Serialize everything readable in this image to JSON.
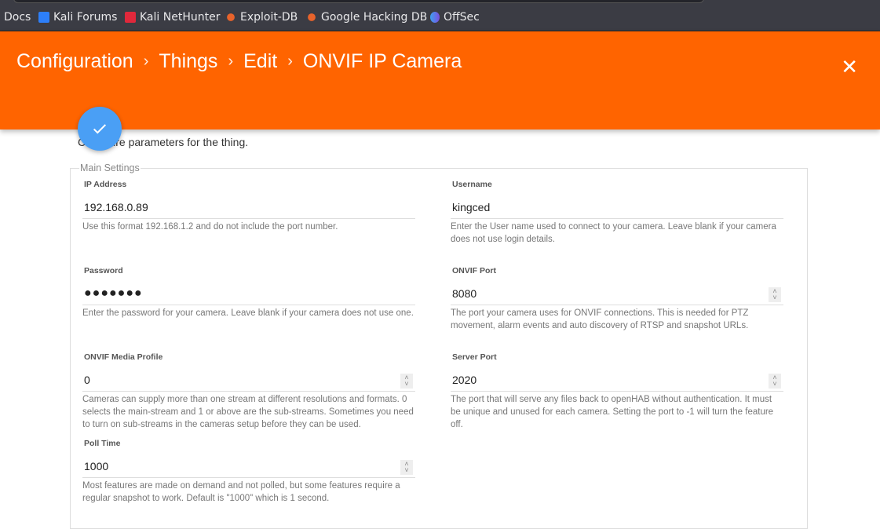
{
  "bookmarks": [
    {
      "label": "Docs",
      "icon": "none"
    },
    {
      "label": "Kali Forums",
      "icon": "kali-forums-icon",
      "color": "#2d7ff9"
    },
    {
      "label": "Kali NetHunter",
      "icon": "nethunter-icon",
      "color": "#e0283b"
    },
    {
      "label": "Exploit-DB",
      "icon": "exploitdb-icon",
      "color": "#e8632b"
    },
    {
      "label": "Google Hacking DB",
      "icon": "ghdb-icon",
      "color": "#e8632b"
    },
    {
      "label": "OffSec",
      "icon": "offsec-icon",
      "color": "#5a6cf0"
    }
  ],
  "header": {
    "crumbs": [
      "Configuration",
      "Things",
      "Edit",
      "ONVIF IP Camera"
    ],
    "close": "✕",
    "accent": "#ff6400"
  },
  "save_icon": "check-icon",
  "intro": "Configure parameters for the thing.",
  "group": "Main Settings",
  "fields": [
    {
      "label": "IP Address",
      "value": "192.168.0.89",
      "help": "Use this format 192.168.1.2 and do not include the port number."
    },
    {
      "label": "Username",
      "value": "kingced",
      "help": "Enter the User name used to connect to your camera. Leave blank if your camera does not use login details."
    },
    {
      "label": "Password",
      "value": "●●●●●●●",
      "help": "Enter the password for your camera. Leave blank if your camera does not use one."
    },
    {
      "label": "ONVIF Port",
      "value": "8080",
      "help": "The port your camera uses for ONVIF connections. This is needed for PTZ movement, alarm events and auto discovery of RTSP and snapshot URLs."
    },
    {
      "label": "ONVIF Media Profile",
      "value": "0",
      "help": "Cameras can supply more than one stream at different resolutions and formats. 0 selects the main-stream and 1 or above are the sub-streams. Sometimes you need to turn on sub-streams in the cameras setup before they can be used."
    },
    {
      "label": "Server Port",
      "value": "2020",
      "help": "The port that will serve any files back to openHAB without authentication. It must be unique and unused for each camera. Setting the port to -1 will turn the feature off."
    },
    {
      "label": "Poll Time",
      "value": "1000",
      "help": "Most features are made on demand and not polled, but some features require a regular snapshot to work. Default is \"1000\" which is 1 second."
    }
  ]
}
